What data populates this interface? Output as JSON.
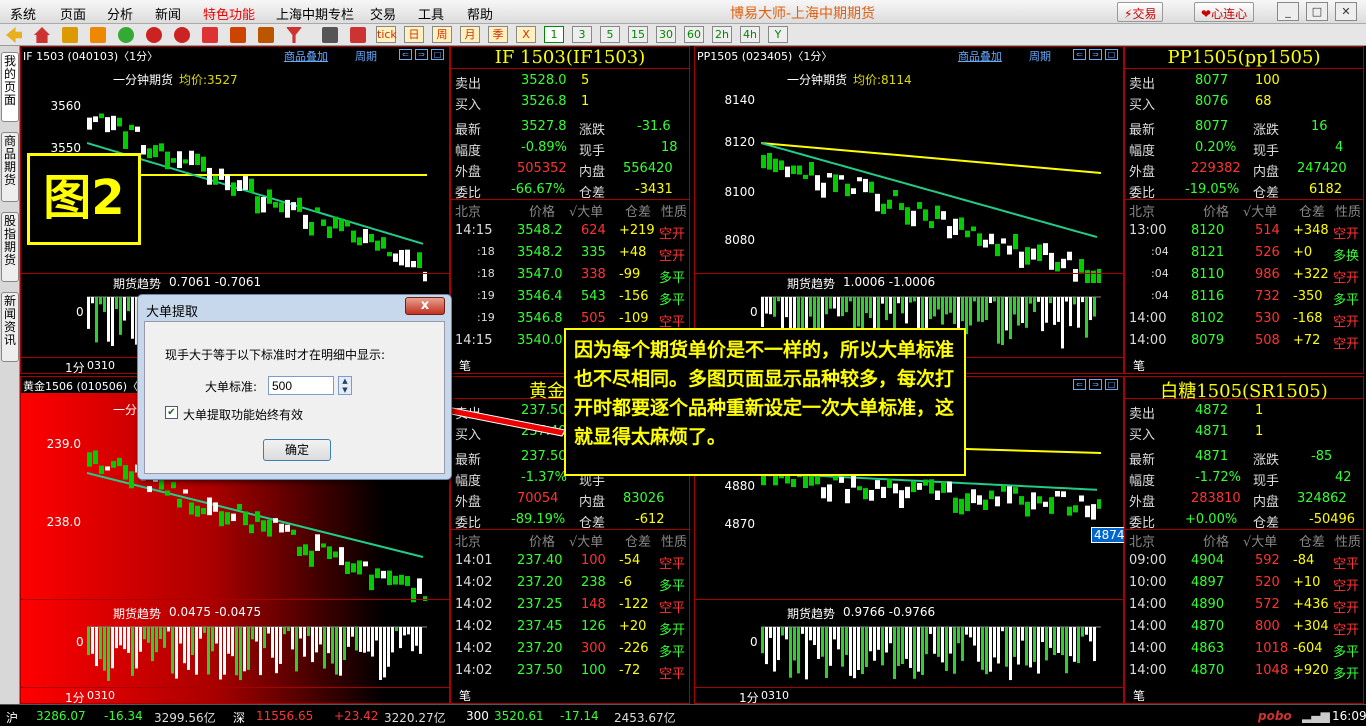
{
  "menu": {
    "items": [
      "系统",
      "页面",
      "分析",
      "新闻",
      "特色功能",
      "上海中期专栏",
      "交易",
      "工具",
      "帮助"
    ],
    "app_title": "博易大师-上海中期期货",
    "trade_btn": "交易",
    "xinlian_btn": "心连心"
  },
  "toolbar": {
    "labels": [
      "1",
      "3",
      "5",
      "15",
      "30",
      "60",
      "2h",
      "4h",
      "Y"
    ],
    "special": [
      "tick",
      "日",
      "周",
      "月",
      "季",
      "X"
    ]
  },
  "sidetabs": [
    "我的页面",
    "商品期货",
    "股指期货",
    "新闻资讯"
  ],
  "panels": [
    {
      "code": "IF   1503 (040103)〈1分〉",
      "overlay": "商品叠加",
      "period": "周期",
      "chart_title": "一分钟期货",
      "avg": "均价:3527",
      "y_ticks": [
        "3560",
        "3550"
      ],
      "trend_title": "期货趋势",
      "trend_vals": "0.7061 -0.7061",
      "trend_zero": "0",
      "xlabel": "1分",
      "xtime": "0310",
      "quote": {
        "title": "IF   1503(IF1503)",
        "sell_l": "卖出",
        "sell_p": "3528.0",
        "sell_v": "5",
        "buy_l": "买入",
        "buy_p": "3526.8",
        "buy_v": "1",
        "last_l": "最新",
        "last": "3527.8",
        "chg_l": "涨跌",
        "chg": "-31.6",
        "amp_l": "幅度",
        "amp": "-0.89%",
        "cur_l": "现手",
        "cur": "18",
        "out_l": "外盘",
        "out": "505352",
        "in_l": "内盘",
        "in": "556420",
        "wb_l": "委比",
        "wb": "-66.67%",
        "oi_l": "仓差",
        "oi": "-3431",
        "th": [
          "北京",
          "价格",
          "√大单",
          "仓差",
          "性质"
        ],
        "ticks": [
          [
            "14:15",
            "3548.2",
            "624",
            "+219",
            "空开"
          ],
          [
            ":18",
            "3548.2",
            "335",
            "+48",
            "空开"
          ],
          [
            ":18",
            "3547.0",
            "338",
            "-99",
            "多平"
          ],
          [
            ":19",
            "3546.4",
            "543",
            "-156",
            "多平"
          ],
          [
            ":19",
            "3546.8",
            "505",
            "-109",
            "空平"
          ],
          [
            "14:15",
            "3540.0",
            "",
            "",
            ""
          ]
        ],
        "bi": "笔"
      }
    },
    {
      "code": "PP1505 (023405)〈1分〉",
      "overlay": "商品叠加",
      "period": "周期",
      "chart_title": "一分钟期货",
      "avg": "均价:8114",
      "y_ticks": [
        "8140",
        "8120",
        "8100",
        "8080"
      ],
      "trend_title": "期货趋势",
      "trend_vals": "1.0006 -1.0006",
      "trend_zero": "0",
      "xlabel": "1分",
      "xtime": "0310",
      "quote": {
        "title": "PP1505(pp1505)",
        "sell_l": "卖出",
        "sell_p": "8077",
        "sell_v": "100",
        "buy_l": "买入",
        "buy_p": "8076",
        "buy_v": "68",
        "last_l": "最新",
        "last": "8077",
        "chg_l": "涨跌",
        "chg": "16",
        "amp_l": "幅度",
        "amp": "0.20%",
        "cur_l": "现手",
        "cur": "4",
        "out_l": "外盘",
        "out": "229382",
        "in_l": "内盘",
        "in": "247420",
        "wb_l": "委比",
        "wb": "-19.05%",
        "oi_l": "仓差",
        "oi": "6182",
        "th": [
          "北京",
          "价格",
          "√大单",
          "仓差",
          "性质"
        ],
        "ticks": [
          [
            "13:00",
            "8120",
            "514",
            "+348",
            "空开"
          ],
          [
            ":04",
            "8121",
            "526",
            "+0",
            "多换"
          ],
          [
            ":04",
            "8110",
            "986",
            "+322",
            "空开"
          ],
          [
            ":04",
            "8116",
            "732",
            "-350",
            "多平"
          ],
          [
            "14:00",
            "8102",
            "530",
            "-168",
            "空开"
          ],
          [
            "14:00",
            "8079",
            "508",
            "+72",
            "空开"
          ]
        ],
        "bi": "笔"
      }
    },
    {
      "code": "黄金1506 (010506)〈1分〉",
      "overlay": "商品叠加",
      "period": "周期",
      "chart_title": "一分",
      "avg": "",
      "y_ticks": [
        "239.0",
        "238.0"
      ],
      "trend_title": "期货趋势",
      "trend_vals": "0.0475 -0.0475",
      "trend_zero": "0",
      "xlabel": "1分",
      "xtime": "0310",
      "quote": {
        "title": "黄金1506",
        "sell_l": "卖出",
        "sell_p": "237.50",
        "sell_v": "",
        "buy_l": "买入",
        "buy_p": "237.40",
        "buy_v": "",
        "last_l": "最新",
        "last": "237.50",
        "chg_l": "涨跌",
        "chg": "",
        "amp_l": "幅度",
        "amp": "-1.37%",
        "cur_l": "现手",
        "cur": "",
        "out_l": "外盘",
        "out": "70054",
        "in_l": "内盘",
        "in": "83026",
        "wb_l": "委比",
        "wb": "-89.19%",
        "oi_l": "仓差",
        "oi": "-612",
        "th": [
          "北京",
          "价格",
          "√大单",
          "仓差",
          "性质"
        ],
        "ticks": [
          [
            "14:01",
            "237.40",
            "100",
            "-54",
            "空平"
          ],
          [
            "14:02",
            "237.20",
            "238",
            "-6",
            "多平"
          ],
          [
            "14:02",
            "237.25",
            "148",
            "-122",
            "空平"
          ],
          [
            "14:02",
            "237.45",
            "126",
            "+20",
            "多开"
          ],
          [
            "14:02",
            "237.20",
            "300",
            "-226",
            "多平"
          ],
          [
            "14:02",
            "237.50",
            "100",
            "-72",
            "空平"
          ]
        ],
        "bi": "笔"
      }
    },
    {
      "code": "",
      "overlay": "",
      "period": "",
      "chart_title": "",
      "avg": "",
      "y_ticks": [
        "4880",
        "4870"
      ],
      "trend_title": "期货趋势",
      "trend_vals": "0.9766 -0.9766",
      "trend_zero": "0",
      "xlabel": "1分",
      "xtime": "0310",
      "price_tag": "4874",
      "quote": {
        "title": "白糖1505(SR1505)",
        "sell_l": "卖出",
        "sell_p": "4872",
        "sell_v": "1",
        "buy_l": "买入",
        "buy_p": "4871",
        "buy_v": "1",
        "last_l": "最新",
        "last": "4871",
        "chg_l": "涨跌",
        "chg": "-85",
        "amp_l": "幅度",
        "amp": "-1.72%",
        "cur_l": "现手",
        "cur": "42",
        "out_l": "外盘",
        "out": "283810",
        "in_l": "内盘",
        "in": "324862",
        "wb_l": "委比",
        "wb": "+0.00%",
        "oi_l": "仓差",
        "oi": "-50496",
        "th": [
          "北京",
          "价格",
          "√大单",
          "仓差",
          "性质"
        ],
        "ticks": [
          [
            "09:00",
            "4904",
            "592",
            "-84",
            "空平"
          ],
          [
            "10:00",
            "4897",
            "520",
            "+10",
            "空开"
          ],
          [
            "14:00",
            "4890",
            "572",
            "+436",
            "空开"
          ],
          [
            "14:00",
            "4870",
            "800",
            "+304",
            "空开"
          ],
          [
            "14:00",
            "4863",
            "1018",
            "-604",
            "多平"
          ],
          [
            "14:00",
            "4870",
            "1048",
            "+920",
            "多开"
          ]
        ],
        "bi": "笔"
      }
    }
  ],
  "dialog": {
    "title": "大单提取",
    "close": "x",
    "desc": "现手大于等于以下标准时才在明细中显示:",
    "std_label": "大单标准:",
    "std_value": "500",
    "always_label": "大单提取功能始终有效",
    "ok": "确定"
  },
  "annotation": "因为每个期货单价是不一样的，所以大单标准也不尽相同。多图页面显示品种较多，每次打开时都要逐个品种重新设定一次大单标准，这就显得太麻烦了。",
  "fig_label": "图2",
  "status": {
    "sh_l": "沪",
    "sh": "3286.07",
    "sh_chg": "-16.34",
    "sh_amt": "3299.56亿",
    "sz_l": "深",
    "sz": "11556.65",
    "sz_chg": "+23.42",
    "sz_amt": "3220.27亿",
    "i300_l": "300",
    "i300": "3520.61",
    "i300_chg": "-17.14",
    "i300_amt": "2453.67亿",
    "brand": "pobo",
    "time": "16:09"
  }
}
